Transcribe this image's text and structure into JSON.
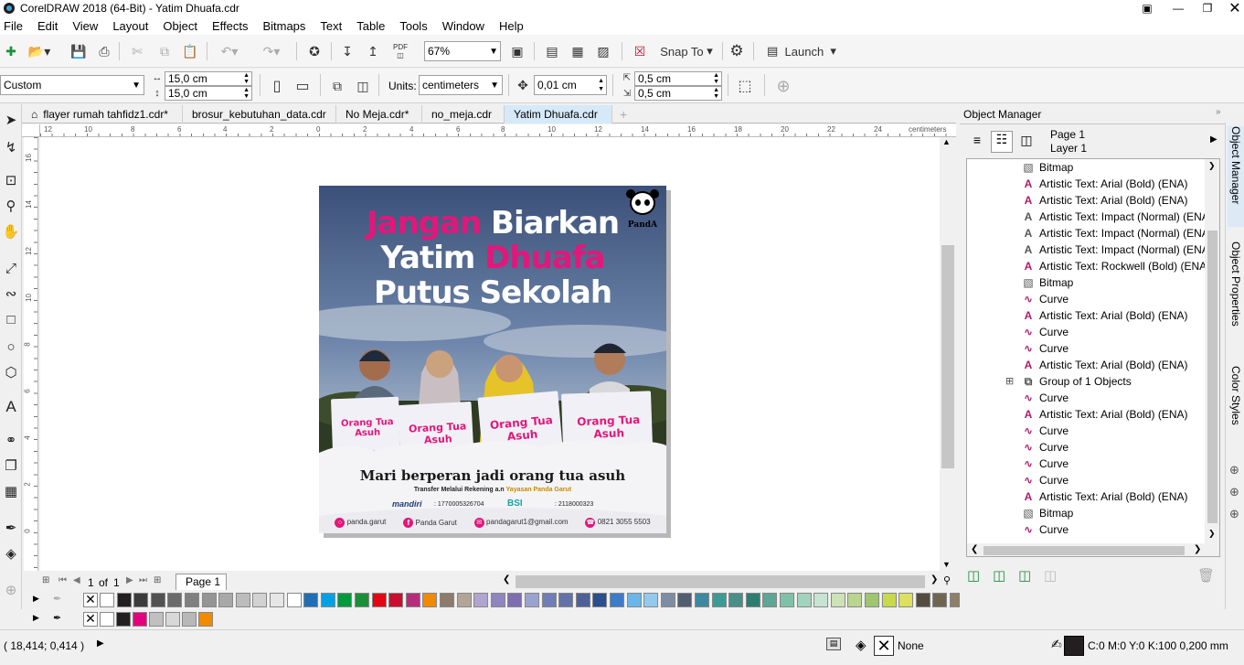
{
  "app": {
    "title": "CorelDRAW 2018 (64-Bit) - Yatim Dhuafa.cdr"
  },
  "menu": [
    "File",
    "Edit",
    "View",
    "Layout",
    "Object",
    "Effects",
    "Bitmaps",
    "Text",
    "Table",
    "Tools",
    "Window",
    "Help"
  ],
  "toolbar": {
    "zoom": "67%",
    "snap_to": "Snap To",
    "launch": "Launch"
  },
  "propbar": {
    "page_size": "Custom",
    "width": "15,0 cm",
    "height": "15,0 cm",
    "units_label": "Units:",
    "units_value": "centimeters",
    "nudge": "0,01 cm",
    "dup_x": "0,5 cm",
    "dup_y": "0,5 cm"
  },
  "doc_tabs": [
    "flayer rumah tahfidz1.cdr*",
    "brosur_kebutuhan_data.cdr",
    "No Meja.cdr*",
    "no_meja.cdr",
    "Yatim Dhuafa.cdr"
  ],
  "ruler": {
    "units": "centimeters",
    "h_labels": [
      "12",
      "10",
      "8",
      "6",
      "4",
      "2",
      "0",
      "2",
      "4",
      "6",
      "8",
      "10",
      "12",
      "14",
      "16",
      "18",
      "20",
      "22",
      "24"
    ],
    "v_labels": [
      "16",
      "14",
      "12",
      "10",
      "8",
      "6",
      "4",
      "2",
      "0",
      "-2"
    ]
  },
  "poster": {
    "headline_1a": "Jangan",
    "headline_1b": "Biarkan",
    "headline_2a": "Yatim",
    "headline_2b": "Dhuafa",
    "headline_3": "Putus Sekolah",
    "logo_text": "PandA",
    "card_title": "Orang Tua Asuh",
    "tagline": "Mari berperan jadi orang tua asuh",
    "transfer_a": "Transfer Melalui Rekening a.n",
    "transfer_b": "Yayasan Panda Garut",
    "bank1": "mandiri",
    "acc1": ": 1770005326704",
    "bank2": "BSI",
    "acc2": ": 2118000323",
    "ig": "panda.garut",
    "fb": "Panda Garut",
    "email": "pandagarut1@gmail.com",
    "phone": "0821 3055 5503"
  },
  "pagebar": {
    "current": "1",
    "of": "of",
    "total": "1",
    "page_tab": "Page 1"
  },
  "status": {
    "coords": "( 18,414; 0,414 )",
    "fill": "None",
    "outline": "C:0 M:0 Y:0 K:100  0,200 mm"
  },
  "object_manager": {
    "title": "Object Manager",
    "page": "Page 1",
    "layer": "Layer 1",
    "items": [
      {
        "icon": "bitmap-icon",
        "label": "Bitmap"
      },
      {
        "icon": "artistic-text-icon",
        "label": "Artistic Text: Arial (Bold) (ENA)"
      },
      {
        "icon": "artistic-text-icon",
        "label": "Artistic Text: Arial (Bold) (ENA)"
      },
      {
        "icon": "artistic-text-outline-icon",
        "label": "Artistic Text: Impact (Normal) (ENA"
      },
      {
        "icon": "artistic-text-outline-icon",
        "label": "Artistic Text: Impact (Normal) (ENA"
      },
      {
        "icon": "artistic-text-outline-icon",
        "label": "Artistic Text: Impact (Normal) (ENA"
      },
      {
        "icon": "artistic-text-icon",
        "label": "Artistic Text: Rockwell (Bold) (ENA)"
      },
      {
        "icon": "bitmap-icon",
        "label": "Bitmap"
      },
      {
        "icon": "curve-icon",
        "label": "Curve"
      },
      {
        "icon": "artistic-text-icon",
        "label": "Artistic Text: Arial (Bold) (ENA)"
      },
      {
        "icon": "curve-icon",
        "label": "Curve"
      },
      {
        "icon": "curve-icon",
        "label": "Curve"
      },
      {
        "icon": "artistic-text-icon",
        "label": "Artistic Text: Arial (Bold) (ENA)"
      },
      {
        "icon": "group-icon",
        "label": "Group of 1 Objects"
      },
      {
        "icon": "curve-icon",
        "label": "Curve"
      },
      {
        "icon": "artistic-text-icon",
        "label": "Artistic Text: Arial (Bold) (ENA)"
      },
      {
        "icon": "curve-icon",
        "label": "Curve"
      },
      {
        "icon": "curve-icon",
        "label": "Curve"
      },
      {
        "icon": "curve-icon",
        "label": "Curve"
      },
      {
        "icon": "curve-icon",
        "label": "Curve"
      },
      {
        "icon": "artistic-text-icon",
        "label": "Artistic Text: Arial (Bold) (ENA)"
      },
      {
        "icon": "bitmap-icon",
        "label": "Bitmap"
      },
      {
        "icon": "curve-icon",
        "label": "Curve"
      }
    ]
  },
  "docker_tabs": [
    "Object Manager",
    "Object Properties",
    "Color Styles"
  ],
  "palette": [
    "#ffffff",
    "#231f20",
    "#3c3c3c",
    "#525252",
    "#6b6b6b",
    "#808080",
    "#959595",
    "#a8a8a8",
    "#bcbcbc",
    "#d2d2d2",
    "#e6e6e6",
    "#ffffff",
    "#1f6fb7",
    "#00a0e3",
    "#009a3e",
    "#1a8f3a",
    "#e30613",
    "#c8102e",
    "#b62d7e",
    "#f08a00",
    "#8d7b6b",
    "#b3a49a",
    "#b1a4cf",
    "#8f86c0",
    "#7f6db2",
    "#9aa2cf",
    "#6f7eb6",
    "#6172a8",
    "#4d6099",
    "#2b4e8c",
    "#3d7cc9",
    "#6ab6e8",
    "#93c9ec",
    "#7e8da3",
    "#525f72",
    "#3d8aa0",
    "#3b9b97",
    "#4a8e88",
    "#2e7d71",
    "#5ea696",
    "#7fc1a8",
    "#a3d3bf",
    "#c6e4d4",
    "#cde2b6",
    "#b9d58f",
    "#9dc66e",
    "#c8d94a",
    "#dce05a",
    "#544c3e",
    "#706550",
    "#8d806a",
    "#a59779",
    "#e9e18a",
    "#fbf4a4",
    "#fdf5b6",
    "#fff8c9",
    "#f2c66a",
    "#f3b13e",
    "#ec9b28",
    "#e67e22",
    "#d96a17",
    "#cc5a10",
    "#c0502a",
    "#e06a3a"
  ],
  "palette2": [
    "#ffffff",
    "#231f20",
    "#e5007e",
    "#c0c0c0",
    "#d8d8d8",
    "#b8b8b8",
    "#f08a00"
  ]
}
